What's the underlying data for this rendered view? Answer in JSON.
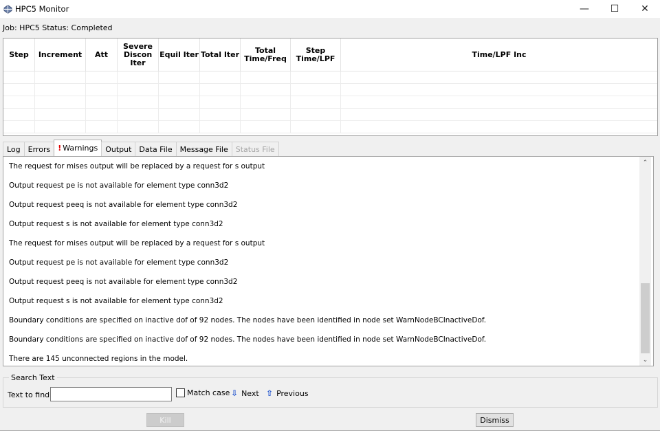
{
  "window": {
    "title": "HPC5 Monitor",
    "icon": "hpc5-app-icon",
    "controls": {
      "minimize": "—",
      "maximize": "☐",
      "close": "✕"
    }
  },
  "job": {
    "job_label": "Job:",
    "job_name": "HPC5",
    "status_label": "Status:",
    "status_value": "Completed"
  },
  "progress_table": {
    "columns": [
      {
        "label": "Step"
      },
      {
        "label": "Increment"
      },
      {
        "label": "Att"
      },
      {
        "label": "Severe Discon Iter"
      },
      {
        "label": "Equil Iter"
      },
      {
        "label": "Total Iter"
      },
      {
        "label": "Total Time/Freq"
      },
      {
        "label": "Step Time/LPF"
      },
      {
        "label": "Time/LPF Inc"
      }
    ],
    "rows": []
  },
  "tabs": [
    {
      "label": "Log",
      "state": "normal"
    },
    {
      "label": "Errors",
      "state": "normal"
    },
    {
      "label": "Warnings",
      "state": "active",
      "marker": "!"
    },
    {
      "label": "Output",
      "state": "normal"
    },
    {
      "label": "Data File",
      "state": "normal"
    },
    {
      "label": "Message File",
      "state": "normal"
    },
    {
      "label": "Status File",
      "state": "disabled"
    }
  ],
  "warnings_log": [
    "The request for mises output will be replaced by a request for s output",
    "Output request pe is not available for element type conn3d2",
    "Output request peeq is not available for element type conn3d2",
    "Output request s is not available for element type conn3d2",
    "The request for mises output will be replaced by a request for s output",
    "Output request pe is not available for element type conn3d2",
    "Output request peeq is not available for element type conn3d2",
    "Output request s is not available for element type conn3d2",
    "Boundary conditions are specified on inactive dof of 92 nodes. The nodes have been identified in node set WarnNodeBCInactiveDof.",
    "Boundary conditions are specified on inactive dof of 92 nodes. The nodes have been identified in node set WarnNodeBCInactiveDof.",
    "There are 145 unconnected regions in the model."
  ],
  "scrollbar": {
    "up": "⌃",
    "down": "⌄"
  },
  "search": {
    "group_label": "Search Text",
    "field_label": "Text to find:",
    "value": "",
    "match_case_label": "Match case",
    "match_case_checked": false,
    "next_label": "Next",
    "next_icon": "⇩",
    "previous_label": "Previous",
    "previous_icon": "⇧"
  },
  "buttons": {
    "kill_label": "Kill",
    "kill_enabled": false,
    "dismiss_label": "Dismiss"
  }
}
